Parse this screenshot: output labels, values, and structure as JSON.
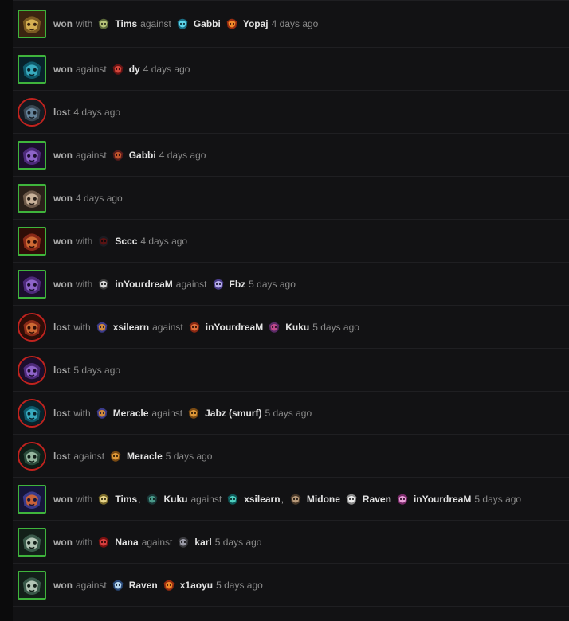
{
  "time_unit": "days ago",
  "colors": {
    "won_border": "#3fb43c",
    "lost_border": "#c0231f"
  },
  "rows": [
    {
      "result": "won",
      "hero_icon": "spider-hero-icon",
      "segments": [
        {
          "type": "word",
          "text": "with"
        },
        {
          "type": "player",
          "name": "Tims",
          "icon": "goblin-hero-icon"
        },
        {
          "type": "word",
          "text": "against"
        },
        {
          "type": "player",
          "name": "Gabbi",
          "icon": "crystal-hero-icon"
        },
        {
          "type": "player",
          "name": "Yopaj",
          "icon": "flame-hero-icon"
        }
      ],
      "time": "4 days ago"
    },
    {
      "result": "won",
      "hero_icon": "teal-creature-hero-icon",
      "segments": [
        {
          "type": "word",
          "text": "against"
        },
        {
          "type": "player",
          "name": "dy",
          "icon": "red-hooded-hero-icon"
        }
      ],
      "time": "4 days ago"
    },
    {
      "result": "lost",
      "hero_icon": "blue-helm-hero-icon",
      "segments": [],
      "time": "4 days ago"
    },
    {
      "result": "won",
      "hero_icon": "purple-faceless-hero-icon",
      "segments": [
        {
          "type": "word",
          "text": "against"
        },
        {
          "type": "player",
          "name": "Gabbi",
          "icon": "horned-demon-hero-icon"
        }
      ],
      "time": "4 days ago"
    },
    {
      "result": "won",
      "hero_icon": "skull-hero-icon",
      "segments": [],
      "time": "4 days ago"
    },
    {
      "result": "won",
      "hero_icon": "monkey-hero-icon",
      "segments": [
        {
          "type": "word",
          "text": "with"
        },
        {
          "type": "player",
          "name": "Sccc",
          "icon": "shadow-hero-icon"
        }
      ],
      "time": "4 days ago"
    },
    {
      "result": "won",
      "hero_icon": "purple-faceless-hero-icon",
      "segments": [
        {
          "type": "word",
          "text": "with"
        },
        {
          "type": "player",
          "name": "inYourdreaM",
          "icon": "masked-hero-icon"
        },
        {
          "type": "word",
          "text": "against"
        },
        {
          "type": "player",
          "name": "Fbz",
          "icon": "wisp-hero-icon"
        }
      ],
      "time": "5 days ago"
    },
    {
      "result": "lost",
      "hero_icon": "monkey-hero-icon",
      "segments": [
        {
          "type": "word",
          "text": "with"
        },
        {
          "type": "player",
          "name": "xsilearn",
          "icon": "winged-mage-hero-icon"
        },
        {
          "type": "word",
          "text": "against"
        },
        {
          "type": "player",
          "name": "inYourdreaM",
          "icon": "red-hair-hero-icon"
        },
        {
          "type": "player",
          "name": "Kuku",
          "icon": "purple-bug-hero-icon"
        }
      ],
      "time": "5 days ago"
    },
    {
      "result": "lost",
      "hero_icon": "purple-faceless-hero-icon",
      "segments": [],
      "time": "5 days ago"
    },
    {
      "result": "lost",
      "hero_icon": "teal-creature-hero-icon",
      "segments": [
        {
          "type": "word",
          "text": "with"
        },
        {
          "type": "player",
          "name": "Meracle",
          "icon": "winged-mage-hero-icon"
        },
        {
          "type": "word",
          "text": "against"
        },
        {
          "type": "player",
          "name": "Jabz (smurf)",
          "icon": "lion-hero-icon"
        }
      ],
      "time": "5 days ago"
    },
    {
      "result": "lost",
      "hero_icon": "green-hood-hero-icon",
      "segments": [
        {
          "type": "word",
          "text": "against"
        },
        {
          "type": "player",
          "name": "Meracle",
          "icon": "lion-hero-icon"
        }
      ],
      "time": "5 days ago"
    },
    {
      "result": "won",
      "hero_icon": "crowned-bird-hero-icon",
      "segments": [
        {
          "type": "word",
          "text": "with"
        },
        {
          "type": "player",
          "name": "Tims",
          "icon": "gold-beast-hero-icon",
          "comma": true
        },
        {
          "type": "player",
          "name": "Kuku",
          "icon": "dark-spider-hero-icon"
        },
        {
          "type": "word",
          "text": "against"
        },
        {
          "type": "player",
          "name": "xsilearn",
          "icon": "teal-horn-hero-icon",
          "comma": true
        },
        {
          "type": "player",
          "name": "Midone",
          "icon": "bearded-hero-icon"
        },
        {
          "type": "player",
          "name": "Raven",
          "icon": "white-beast-hero-icon"
        },
        {
          "type": "player",
          "name": "inYourdreaM",
          "icon": "pink-hair-hero-icon"
        }
      ],
      "time": "5 days ago"
    },
    {
      "result": "won",
      "hero_icon": "horned-ogre-hero-icon",
      "segments": [
        {
          "type": "word",
          "text": "with"
        },
        {
          "type": "player",
          "name": "Nana",
          "icon": "red-bat-hero-icon"
        },
        {
          "type": "word",
          "text": "against"
        },
        {
          "type": "player",
          "name": "karl",
          "icon": "armored-hero-icon"
        }
      ],
      "time": "5 days ago"
    },
    {
      "result": "won",
      "hero_icon": "horned-ogre-hero-icon",
      "segments": [
        {
          "type": "word",
          "text": "against"
        },
        {
          "type": "player",
          "name": "Raven",
          "icon": "ice-hero-icon"
        },
        {
          "type": "player",
          "name": "x1aoyu",
          "icon": "flame-hero-icon"
        }
      ],
      "time": "5 days ago"
    }
  ]
}
